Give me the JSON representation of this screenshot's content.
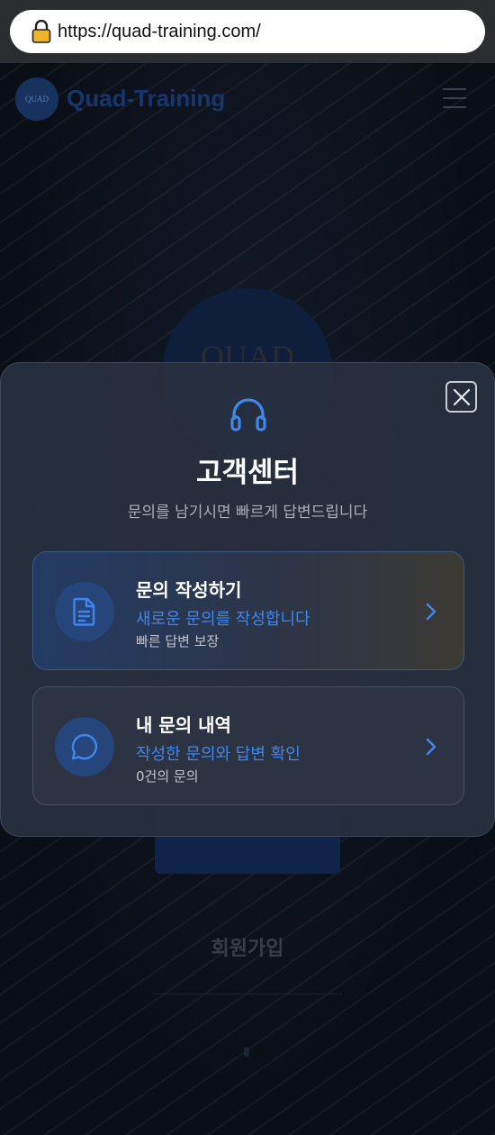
{
  "browser": {
    "url": "https://quad-training.com/",
    "lock_icon": "lock-icon"
  },
  "site": {
    "logo_text": "QUAD",
    "title": "Quad-Training",
    "menu_icon": "hamburger-menu-icon",
    "emblem_text": "QUAD",
    "signup_label": "회원가입"
  },
  "modal": {
    "icon": "headset-icon",
    "title": "고객센터",
    "subtitle": "문의를 남기시면 빠르게 답변드립니다",
    "close_icon": "close-icon",
    "options": [
      {
        "icon": "document-icon",
        "title": "문의 작성하기",
        "description": "새로운 문의를 작성합니다",
        "meta": "빠른 답변 보장"
      },
      {
        "icon": "chat-bubble-icon",
        "title": "내 문의 내역",
        "description": "작성한 문의와 답변 확인",
        "meta": "0건의 문의"
      }
    ]
  },
  "colors": {
    "accent": "#3f86ef",
    "modal_bg": "#283040",
    "icon_circle": "#26457a"
  }
}
